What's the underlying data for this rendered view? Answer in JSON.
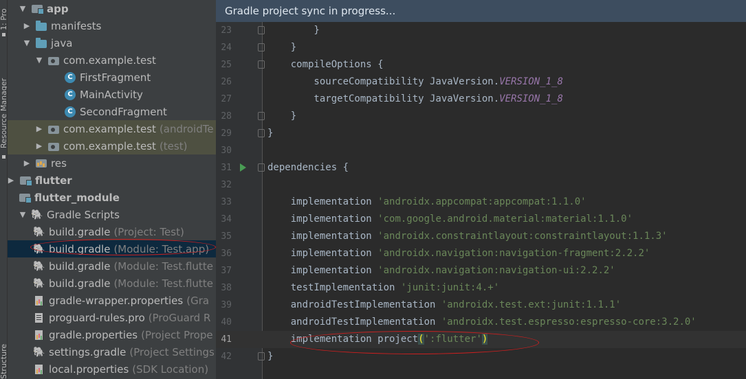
{
  "tool_strip": {
    "project_label": "1: Pro",
    "resource_label": "Resource Manager",
    "structure_label": "Structure"
  },
  "project_tree": {
    "rows": [
      {
        "arrow": "expanded",
        "icon": "module-icon",
        "label": "app",
        "bold": true
      },
      {
        "arrow": "collapsed",
        "icon": "folder-icon",
        "label": "manifests"
      },
      {
        "arrow": "expanded",
        "icon": "folder-icon",
        "label": "java"
      },
      {
        "arrow": "expanded",
        "icon": "package-icon",
        "label": "com.example.test"
      },
      {
        "icon": "class-icon",
        "label": "FirstFragment"
      },
      {
        "icon": "class-icon",
        "label": "MainActivity"
      },
      {
        "icon": "class-icon",
        "label": "SecondFragment"
      },
      {
        "arrow": "collapsed",
        "icon": "package-icon",
        "label": "com.example.test",
        "hint": "(androidTe"
      },
      {
        "arrow": "collapsed",
        "icon": "package-icon",
        "label": "com.example.test",
        "hint": "(test)"
      },
      {
        "arrow": "collapsed",
        "icon": "resource-folder-icon",
        "label": "res"
      },
      {
        "arrow": "collapsed",
        "icon": "module-icon",
        "label": "flutter",
        "bold": true
      },
      {
        "icon": "module-icon",
        "label": "flutter_module",
        "bold": true
      },
      {
        "arrow": "expanded",
        "icon": "gradle-icon",
        "label": "Gradle Scripts"
      },
      {
        "icon": "gradle-icon",
        "label": "build.gradle",
        "hint": "(Project: Test)"
      },
      {
        "icon": "gradle-icon",
        "label": "build.gradle",
        "hint": "(Module: Test.app)"
      },
      {
        "icon": "gradle-icon",
        "label": "build.gradle",
        "hint": "(Module: Test.flutte"
      },
      {
        "icon": "gradle-icon",
        "label": "build.gradle",
        "hint": "(Module: Test.flutte"
      },
      {
        "icon": "properties-icon",
        "label": "gradle-wrapper.properties",
        "hint": "(Gra"
      },
      {
        "icon": "file-icon",
        "label": "proguard-rules.pro",
        "hint": "(ProGuard R"
      },
      {
        "icon": "properties-icon",
        "label": "gradle.properties",
        "hint": "(Project Prope"
      },
      {
        "icon": "gradle-icon",
        "label": "settings.gradle",
        "hint": "(Project Settings"
      },
      {
        "icon": "properties-icon",
        "label": "local.properties",
        "hint": "(SDK Location)"
      }
    ]
  },
  "editor": {
    "sync_banner": "Gradle project sync in progress...",
    "current_line": 41,
    "lines": [
      {
        "num": "23",
        "parts": [
          {
            "t": "        }"
          }
        ]
      },
      {
        "num": "24",
        "parts": [
          {
            "t": "    }"
          }
        ]
      },
      {
        "num": "25",
        "parts": [
          {
            "t": "    compileOptions {"
          }
        ]
      },
      {
        "num": "26",
        "parts": [
          {
            "t": "        sourceCompatibility JavaVersion."
          },
          {
            "t": "VERSION_1_8",
            "c": "enum"
          }
        ]
      },
      {
        "num": "27",
        "parts": [
          {
            "t": "        targetCompatibility JavaVersion."
          },
          {
            "t": "VERSION_1_8",
            "c": "enum"
          }
        ]
      },
      {
        "num": "28",
        "parts": [
          {
            "t": "    }"
          }
        ]
      },
      {
        "num": "29",
        "parts": [
          {
            "t": "}"
          }
        ]
      },
      {
        "num": "30",
        "parts": [
          {
            "t": ""
          }
        ]
      },
      {
        "num": "31",
        "parts": [
          {
            "t": "dependencies {"
          }
        ]
      },
      {
        "num": "32",
        "parts": [
          {
            "t": ""
          }
        ]
      },
      {
        "num": "33",
        "parts": [
          {
            "t": "    implementation "
          },
          {
            "t": "'androidx.appcompat:appcompat:1.1.0'",
            "c": "str"
          }
        ]
      },
      {
        "num": "34",
        "parts": [
          {
            "t": "    implementation "
          },
          {
            "t": "'com.google.android.material:material:1.1.0'",
            "c": "str"
          }
        ]
      },
      {
        "num": "35",
        "parts": [
          {
            "t": "    implementation "
          },
          {
            "t": "'androidx.constraintlayout:constraintlayout:1.1.3'",
            "c": "str"
          }
        ]
      },
      {
        "num": "36",
        "parts": [
          {
            "t": "    implementation "
          },
          {
            "t": "'androidx.navigation:navigation-fragment:2.2.2'",
            "c": "str"
          }
        ]
      },
      {
        "num": "37",
        "parts": [
          {
            "t": "    implementation "
          },
          {
            "t": "'androidx.navigation:navigation-ui:2.2.2'",
            "c": "str"
          }
        ]
      },
      {
        "num": "38",
        "parts": [
          {
            "t": "    testImplementation "
          },
          {
            "t": "'junit:junit:4.+'",
            "c": "str"
          }
        ]
      },
      {
        "num": "39",
        "parts": [
          {
            "t": "    androidTestImplementation "
          },
          {
            "t": "'androidx.test.ext:junit:1.1.1'",
            "c": "str"
          }
        ]
      },
      {
        "num": "40",
        "parts": [
          {
            "t": "    androidTestImplementation "
          },
          {
            "t": "'androidx.test.espresso:espresso-core:3.2.0'",
            "c": "str"
          }
        ]
      },
      {
        "num": "41",
        "parts": [
          {
            "t": "    implementation project"
          },
          {
            "t": "(",
            "c": "brace"
          },
          {
            "t": "':flutter'",
            "c": "str"
          },
          {
            "t": ")",
            "c": "brace"
          }
        ]
      },
      {
        "num": "42",
        "parts": [
          {
            "t": "}"
          }
        ]
      }
    ],
    "fold_lines": [
      "23",
      "24",
      "25",
      "28",
      "29",
      "31",
      "42"
    ],
    "run_lines": [
      "31"
    ]
  },
  "colors": {
    "annotation": "#cc1f1f",
    "string": "#6a8759",
    "enum_constant": "#9876aa",
    "selection": "#0d293e",
    "banner": "#3d4d5f"
  }
}
